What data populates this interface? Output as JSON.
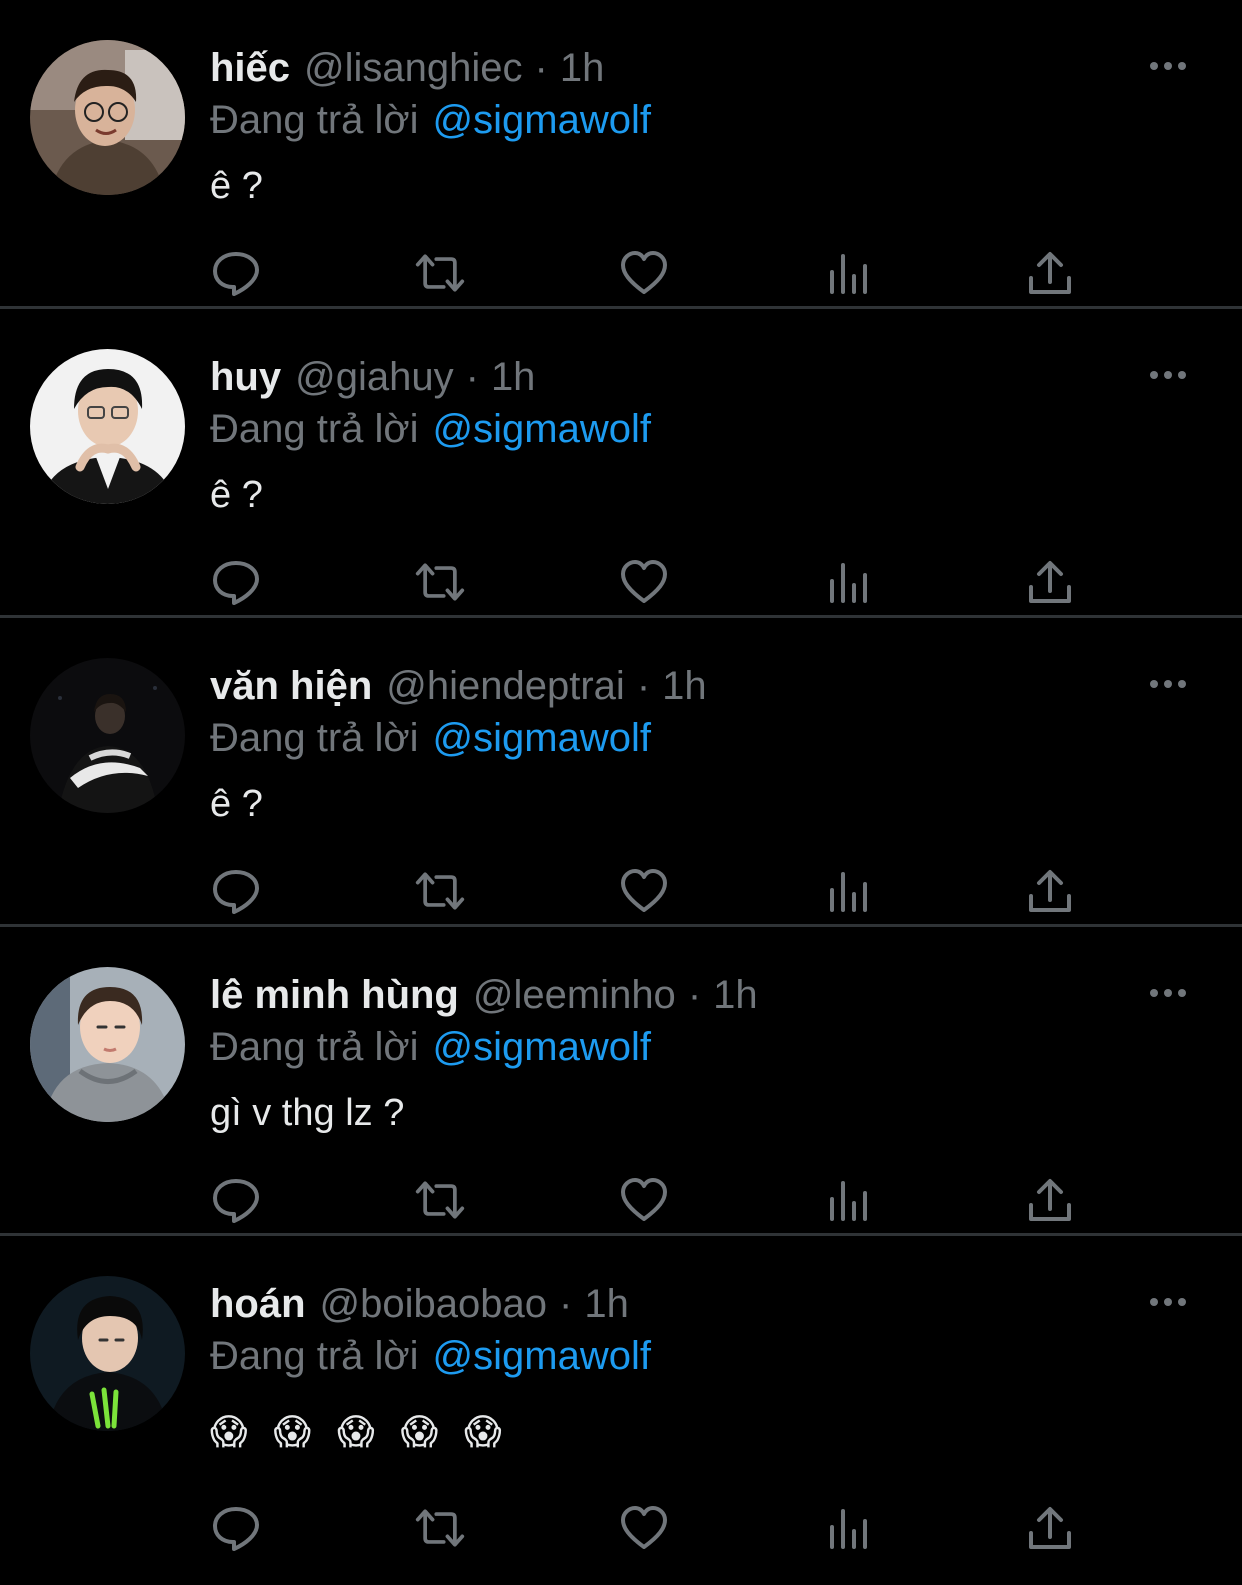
{
  "colors": {
    "background": "#000000",
    "divider": "#2f3336",
    "primary_text": "#e7e9ea",
    "secondary_text": "#71767b",
    "accent": "#1d9bf0"
  },
  "icons": {
    "more": "more-horizontal-icon",
    "reply": "reply-bubble-icon",
    "retweet": "retweet-icon",
    "like": "heart-icon",
    "views": "views-bar-chart-icon",
    "share": "share-upload-icon"
  },
  "tweets": [
    {
      "name": "hiếc",
      "handle": "@lisanghiec",
      "separator": "·",
      "time": "1h",
      "reply_prefix": "Đang trả lời",
      "reply_to": "@sigmawolf",
      "text": "ê ?"
    },
    {
      "name": "huy",
      "handle": "@giahuy",
      "separator": "·",
      "time": "1h",
      "reply_prefix": "Đang trả lời",
      "reply_to": "@sigmawolf",
      "text": "ê ?"
    },
    {
      "name": "văn hiện",
      "handle": "@hiendeptrai",
      "separator": "·",
      "time": "1h",
      "reply_prefix": "Đang trả lời",
      "reply_to": "@sigmawolf",
      "text": "ê ?"
    },
    {
      "name": "lê minh hùng",
      "handle": "@leeminho",
      "separator": "·",
      "time": "1h",
      "reply_prefix": "Đang trả lời",
      "reply_to": "@sigmawolf",
      "text": "gì v thg lz ?"
    },
    {
      "name": "hoán",
      "handle": "@boibaobao",
      "separator": "·",
      "time": "1h",
      "reply_prefix": "Đang trả lời",
      "reply_to": "@sigmawolf",
      "text": "😱 😱 😱 😱 😱"
    }
  ]
}
